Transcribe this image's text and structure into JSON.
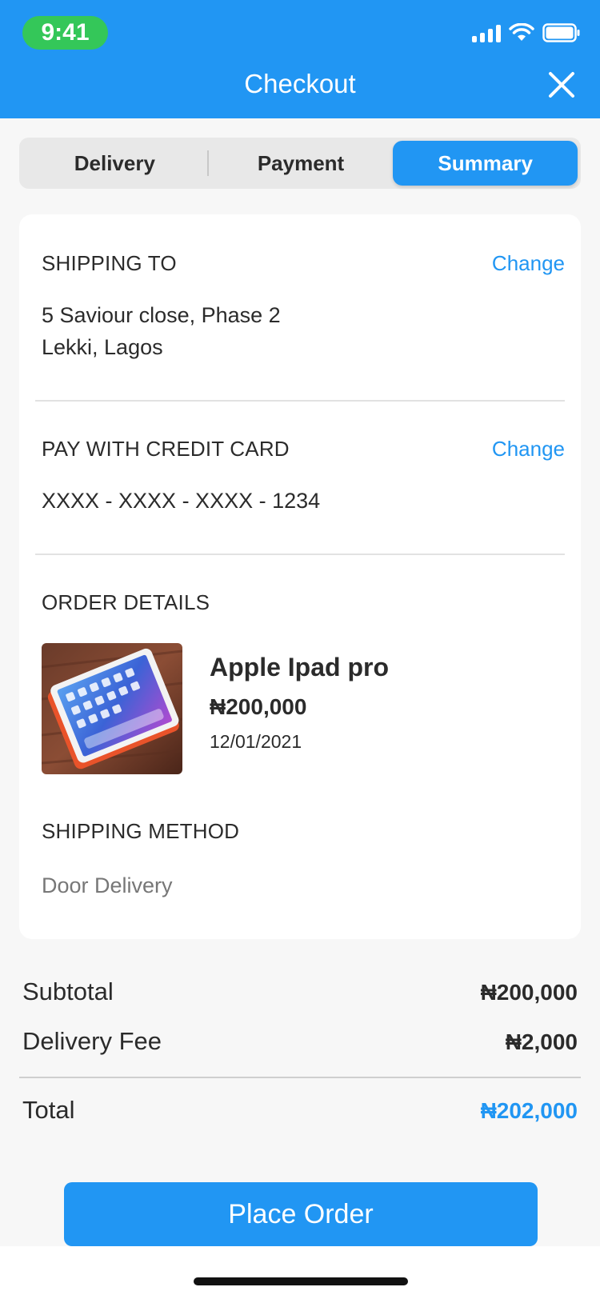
{
  "status_bar": {
    "time": "9:41"
  },
  "header": {
    "title": "Checkout"
  },
  "tabs": [
    {
      "label": "Delivery",
      "active": false
    },
    {
      "label": "Payment",
      "active": false
    },
    {
      "label": "Summary",
      "active": true
    }
  ],
  "shipping": {
    "heading": "SHIPPING TO",
    "change_label": "Change",
    "address_line1": "5 Saviour close, Phase 2",
    "address_line2": "Lekki, Lagos"
  },
  "payment": {
    "heading": "PAY WITH CREDIT CARD",
    "change_label": "Change",
    "card_number": "XXXX - XXXX - XXXX - 1234"
  },
  "order": {
    "heading": "ORDER DETAILS",
    "product_name": "Apple Ipad pro",
    "price": "₦200,000",
    "date": "12/01/2021"
  },
  "shipping_method": {
    "heading": "SHIPPING METHOD",
    "value": "Door Delivery"
  },
  "totals": {
    "subtotal_label": "Subtotal",
    "subtotal_value": "₦200,000",
    "delivery_label": "Delivery Fee",
    "delivery_value": "₦2,000",
    "total_label": "Total",
    "total_value": "₦202,000"
  },
  "actions": {
    "place_order_label": "Place Order"
  },
  "colors": {
    "primary": "#2196f3",
    "time_pill": "#34c759"
  }
}
